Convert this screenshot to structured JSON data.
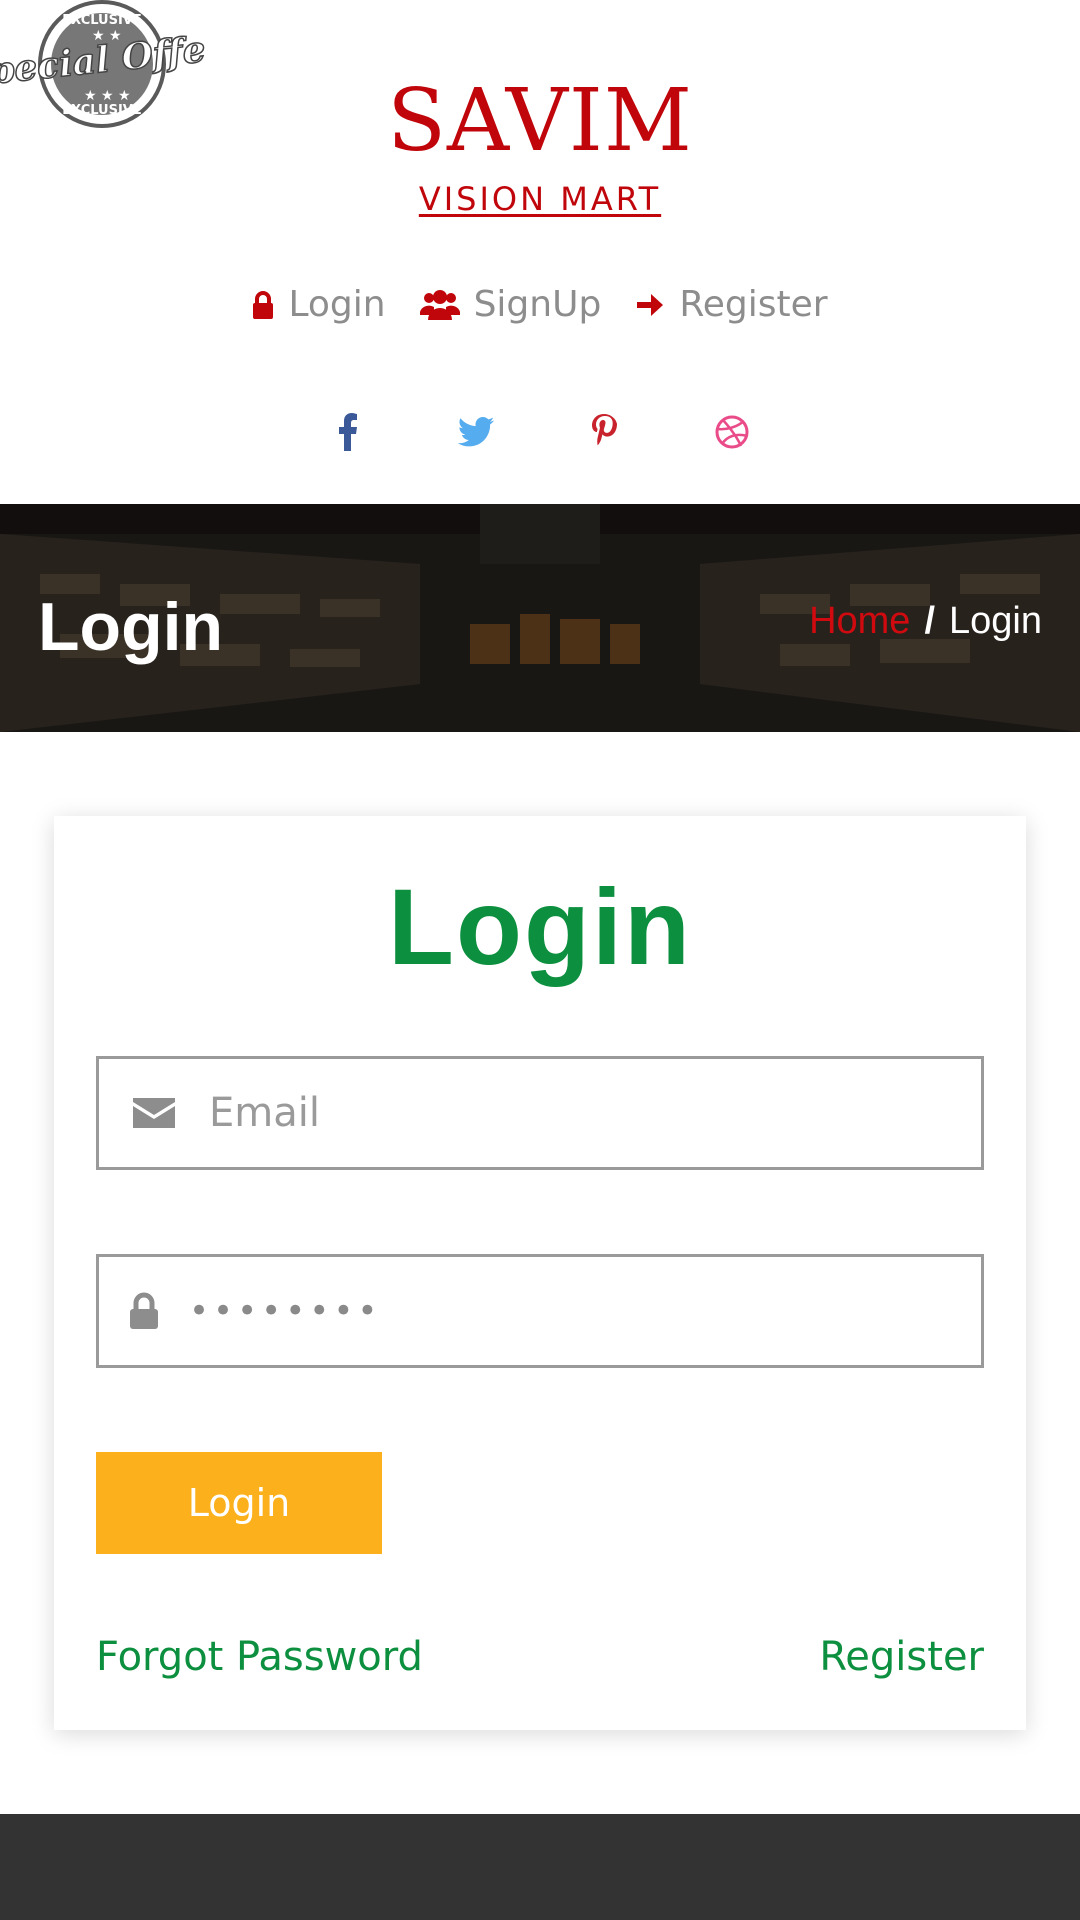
{
  "badge": {
    "top_text": "EXCLUSIVE",
    "main_text": "Special Offer!",
    "bottom_text": "EXCLUSIVE"
  },
  "brand": {
    "title": "SAVIM",
    "subtitle": "VISION MART",
    "color": "#c0060b"
  },
  "topnav": {
    "items": [
      {
        "label": "Login",
        "icon": "lock-icon"
      },
      {
        "label": "SignUp",
        "icon": "users-icon"
      },
      {
        "label": "Register",
        "icon": "arrow-right-icon"
      }
    ]
  },
  "social": {
    "items": [
      {
        "name": "facebook-icon",
        "color": "#3b5998"
      },
      {
        "name": "twitter-icon",
        "color": "#55acee"
      },
      {
        "name": "pinterest-icon",
        "color": "#c8232c"
      },
      {
        "name": "dribbble-icon",
        "color": "#ea4c89"
      }
    ]
  },
  "banner": {
    "title": "Login",
    "breadcrumb": {
      "home": "Home",
      "separator": "/",
      "current": "Login"
    }
  },
  "login_card": {
    "title": "Login",
    "email": {
      "placeholder": "Email",
      "icon": "envelope-icon"
    },
    "password": {
      "value": "••••••••",
      "icon": "lock-icon"
    },
    "submit_label": "Login",
    "forgot_label": "Forgot Password",
    "register_label": "Register",
    "accent_color": "#0c8f3e",
    "button_color": "#fbb01c"
  }
}
